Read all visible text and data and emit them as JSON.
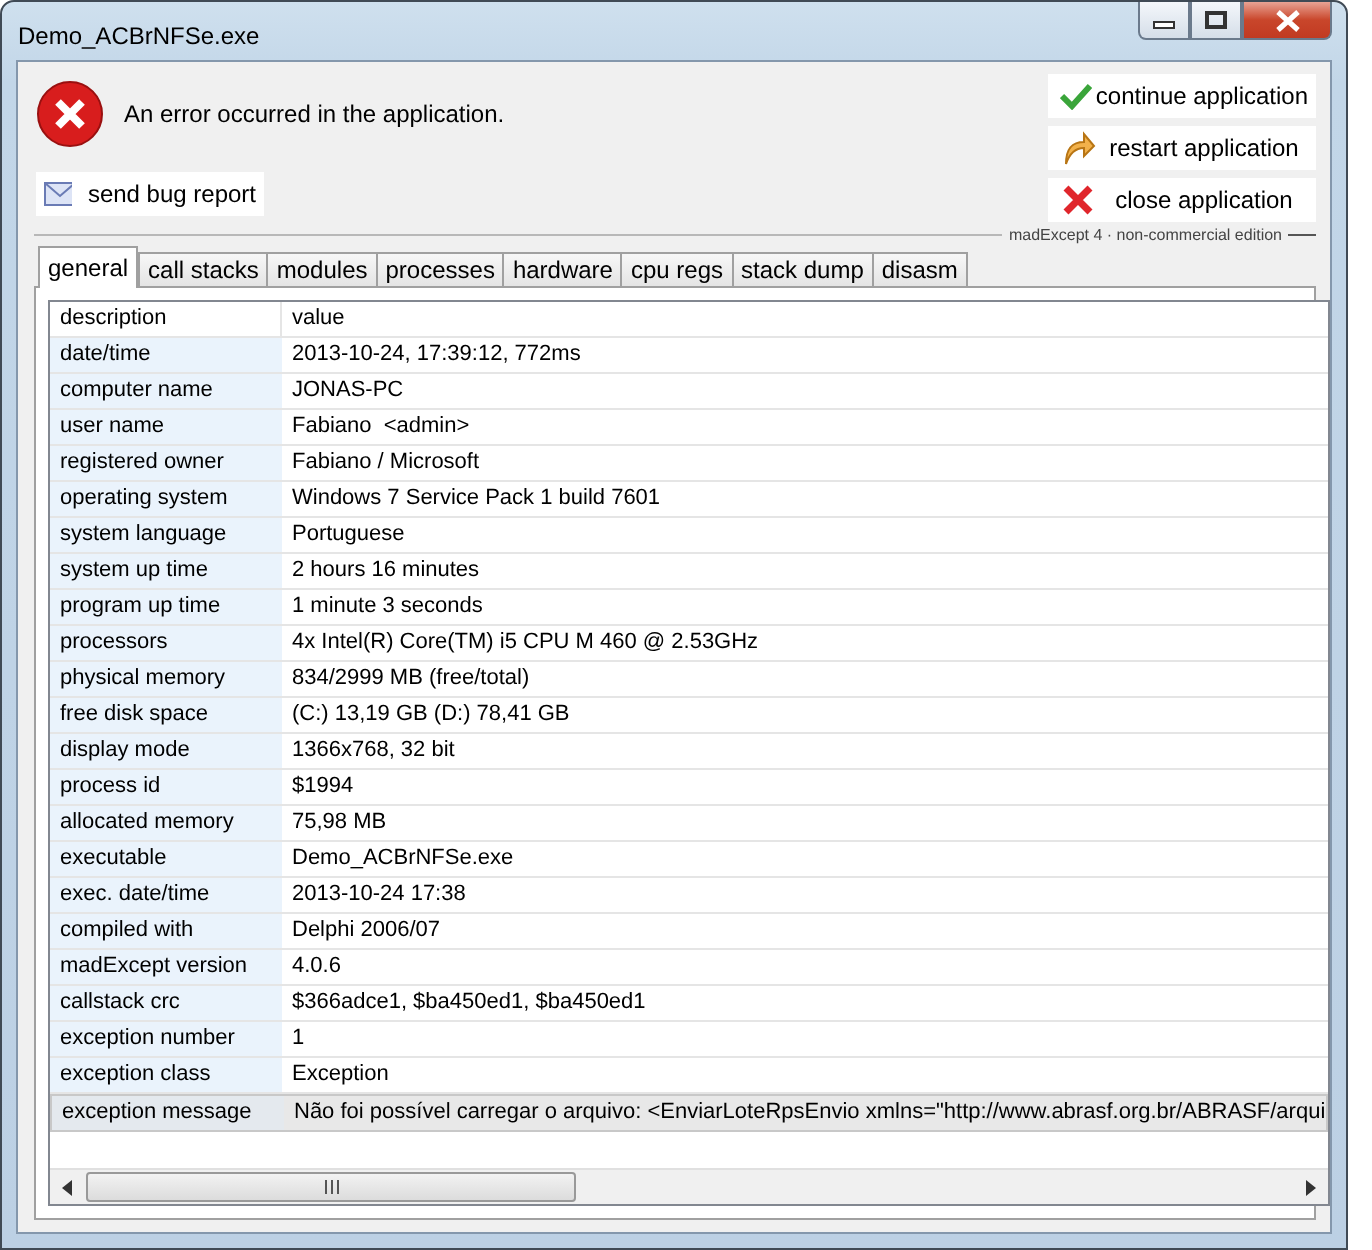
{
  "window": {
    "title": "Demo_ACBrNFSe.exe"
  },
  "message": "An error occurred in the application.",
  "bug_button": {
    "label": "send bug report"
  },
  "actions": [
    {
      "kind": "continue",
      "label": "continue application"
    },
    {
      "kind": "restart",
      "label": "restart application"
    },
    {
      "kind": "close",
      "label": "close application"
    }
  ],
  "edition": "madExcept 4 · non-commercial edition",
  "tabs": [
    {
      "label": "general",
      "selected": true
    },
    {
      "label": "call stacks",
      "selected": false
    },
    {
      "label": "modules",
      "selected": false
    },
    {
      "label": "processes",
      "selected": false
    },
    {
      "label": "hardware",
      "selected": false
    },
    {
      "label": "cpu regs",
      "selected": false
    },
    {
      "label": "stack dump",
      "selected": false
    },
    {
      "label": "disasm",
      "selected": false
    }
  ],
  "table": {
    "columns": [
      "description",
      "value"
    ],
    "rows": [
      {
        "description": "date/time",
        "value": "2013-10-24, 17:39:12, 772ms",
        "selected": false
      },
      {
        "description": "computer name",
        "value": "JONAS-PC",
        "selected": false
      },
      {
        "description": "user name",
        "value": "Fabiano  <admin>",
        "selected": false
      },
      {
        "description": "registered owner",
        "value": "Fabiano / Microsoft",
        "selected": false
      },
      {
        "description": "operating system",
        "value": "Windows 7 Service Pack 1 build 7601",
        "selected": false
      },
      {
        "description": "system language",
        "value": "Portuguese",
        "selected": false
      },
      {
        "description": "system up time",
        "value": "2 hours 16 minutes",
        "selected": false
      },
      {
        "description": "program up time",
        "value": "1 minute 3 seconds",
        "selected": false
      },
      {
        "description": "processors",
        "value": "4x Intel(R) Core(TM) i5 CPU M 460 @ 2.53GHz",
        "selected": false
      },
      {
        "description": "physical memory",
        "value": "834/2999 MB (free/total)",
        "selected": false
      },
      {
        "description": "free disk space",
        "value": "(C:) 13,19 GB (D:) 78,41 GB",
        "selected": false
      },
      {
        "description": "display mode",
        "value": "1366x768, 32 bit",
        "selected": false
      },
      {
        "description": "process id",
        "value": "$1994",
        "selected": false
      },
      {
        "description": "allocated memory",
        "value": "75,98 MB",
        "selected": false
      },
      {
        "description": "executable",
        "value": "Demo_ACBrNFSe.exe",
        "selected": false
      },
      {
        "description": "exec. date/time",
        "value": "2013-10-24 17:38",
        "selected": false
      },
      {
        "description": "compiled with",
        "value": "Delphi 2006/07",
        "selected": false
      },
      {
        "description": "madExcept version",
        "value": "4.0.6",
        "selected": false
      },
      {
        "description": "callstack crc",
        "value": "$366adce1, $ba450ed1, $ba450ed1",
        "selected": false
      },
      {
        "description": "exception number",
        "value": "1",
        "selected": false
      },
      {
        "description": "exception class",
        "value": "Exception",
        "selected": false
      },
      {
        "description": "exception message",
        "value": "Não foi possível carregar o arquivo: <EnviarLoteRpsEnvio xmlns=\"http://www.abrasf.org.br/ABRASF/arqui",
        "selected": true
      }
    ]
  }
}
